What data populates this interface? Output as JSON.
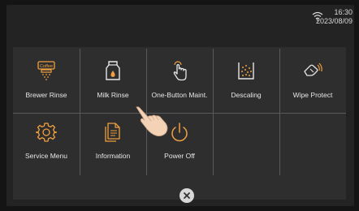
{
  "status": {
    "time": "16:30",
    "date": "2023/08/09",
    "wifi_icon": "wifi-icon"
  },
  "menu": {
    "items": [
      {
        "label": "Brewer Rinse",
        "icon": "coffee-brewer-icon"
      },
      {
        "label": "Milk Rinse",
        "icon": "milk-carton-icon"
      },
      {
        "label": "One-Button Maint.",
        "icon": "touch-hand-icon"
      },
      {
        "label": "Descaling",
        "icon": "descaling-icon"
      },
      {
        "label": "Wipe Protect",
        "icon": "wipe-hand-icon"
      },
      {
        "label": "Service Menu",
        "icon": "gear-icon"
      },
      {
        "label": "Information",
        "icon": "document-icon"
      },
      {
        "label": "Power Off",
        "icon": "power-icon"
      }
    ]
  },
  "colors": {
    "icon_orange": "#f0a040",
    "panel": "#2e2e2e",
    "background": "#232323"
  }
}
